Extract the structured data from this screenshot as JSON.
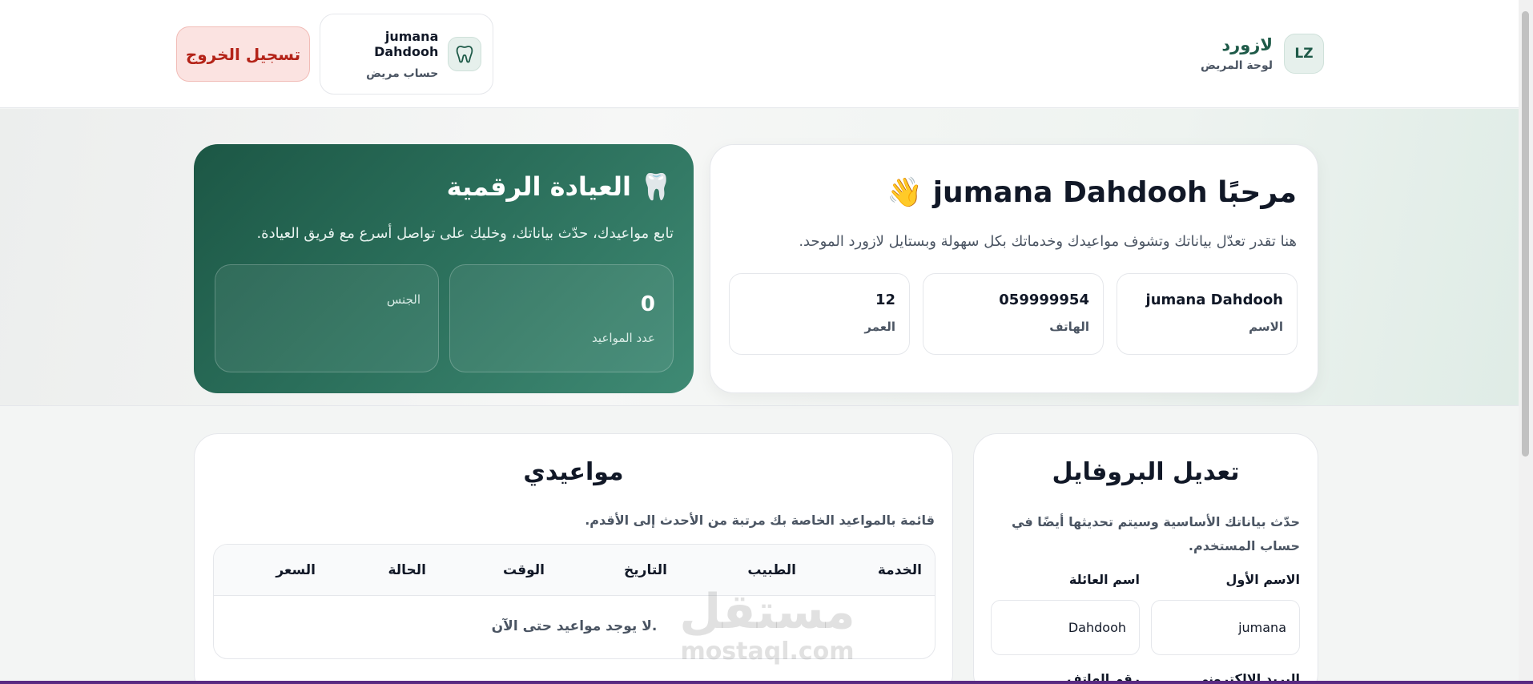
{
  "header": {
    "brand_badge": "LZ",
    "brand_name": "لازورد",
    "brand_subtitle": "لوحة المريض",
    "user_name": "jumana Dahdooh",
    "user_role": "حساب مريض",
    "logout_label": "تسجيل الخروج"
  },
  "welcome": {
    "title": "مرحبًا jumana Dahdooh 👋",
    "subtitle": "هنا تقدر تعدّل بياناتك وتشوف مواعيدك وخدماتك بكل سهولة وبستايل لازورد الموحد.",
    "name_value": "jumana Dahdooh",
    "name_label": "الاسم",
    "phone_value": "059999954",
    "phone_label": "الهاتف",
    "age_value": "12",
    "age_label": "العمر"
  },
  "clinic": {
    "title": "🦷 العيادة الرقمية",
    "subtitle": "تابع مواعيدك، حدّث بياناتك، وخليك على تواصل أسرع مع فريق العيادة.",
    "appointments_count": "0",
    "appointments_label": "عدد المواعيد",
    "gender_label": "الجنس"
  },
  "profile": {
    "title": "تعديل البروفايل",
    "description": "حدّث بياناتك الأساسية وسيتم تحديثها أيضًا في حساب المستخدم.",
    "first_name_label": "الاسم الأول",
    "first_name_value": "jumana",
    "last_name_label": "اسم العائلة",
    "last_name_value": "Dahdooh",
    "email_label": "البريد الإلكتروني",
    "phone_label": "رقم الهاتف"
  },
  "appointments": {
    "title": "مواعيدي",
    "description": "قائمة بالمواعيد الخاصة بك مرتبة من الأحدث إلى الأقدم.",
    "columns": [
      "الخدمة",
      "الطبيب",
      "التاريخ",
      "الوقت",
      "الحالة",
      "السعر"
    ],
    "empty_message": "لا يوجد مواعيد حتى الآن."
  },
  "watermark": {
    "arabic": "مستقل",
    "latin": "mostaql.com"
  },
  "colors": {
    "accent": "#1e5a48",
    "logout_text": "#b42318",
    "logout_bg": "#fbe3e1"
  }
}
